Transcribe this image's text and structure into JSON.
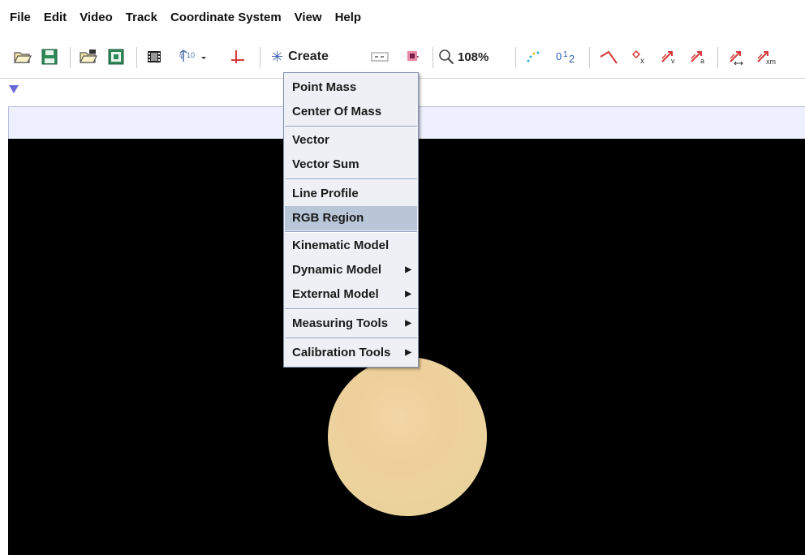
{
  "menubar": {
    "items": [
      "File",
      "Edit",
      "Video",
      "Track",
      "Coordinate System",
      "View",
      "Help"
    ]
  },
  "toolbar": {
    "create_label": "Create",
    "zoom_label": "108%",
    "icons": [
      "open-folder-icon",
      "save-icon",
      "open-video-icon",
      "export-icon",
      "clip-settings-icon",
      "axes-icon",
      "coordinate-axes-icon",
      "create-icon",
      "video-filter-icon",
      "track-control-icon",
      "zoom-icon",
      "trails-icon",
      "label-icon",
      "line-tool-icon",
      "point-x-icon",
      "velocity-vector-icon",
      "acceleration-vector-icon",
      "vector-sum-icon",
      "vector-xm-icon"
    ]
  },
  "create_menu": {
    "items": [
      {
        "label": "Point Mass"
      },
      {
        "label": "Center Of Mass"
      },
      {
        "label": "Vector"
      },
      {
        "label": "Vector Sum"
      },
      {
        "label": "Line Profile"
      },
      {
        "label": "RGB Region",
        "highlighted": true
      },
      {
        "label": "Kinematic Model"
      },
      {
        "label": "Dynamic Model",
        "submenu": true
      },
      {
        "label": "External Model",
        "submenu": true
      },
      {
        "label": "Measuring Tools",
        "submenu": true
      },
      {
        "label": "Calibration Tools",
        "submenu": true
      }
    ]
  },
  "colors": {
    "menu_bg": "#eef0f5",
    "menu_highlight": "#b8c6d8",
    "video_bg": "#000000",
    "disc": "#efcf9b"
  }
}
